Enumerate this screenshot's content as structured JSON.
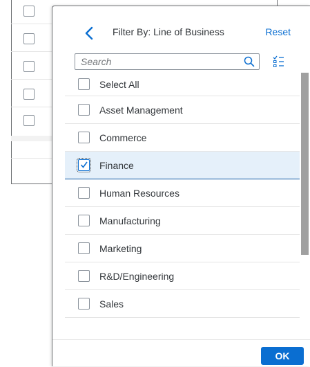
{
  "popover": {
    "title": "Filter By: Line of Business",
    "reset_label": "Reset",
    "ok_label": "OK",
    "back_icon": "navigation-left-arrow",
    "list_icon": "multiselect-list-icon"
  },
  "search": {
    "placeholder": "Search",
    "value": "",
    "icon": "search-icon"
  },
  "list": {
    "select_all_label": "Select All",
    "items": [
      {
        "label": "Asset Management",
        "checked": false
      },
      {
        "label": "Commerce",
        "checked": false
      },
      {
        "label": "Finance",
        "checked": true
      },
      {
        "label": "Human Resources",
        "checked": false
      },
      {
        "label": "Manufacturing",
        "checked": false
      },
      {
        "label": "Marketing",
        "checked": false
      },
      {
        "label": "R&D/Engineering",
        "checked": false
      },
      {
        "label": "Sales",
        "checked": false
      }
    ]
  },
  "colors": {
    "accent": "#0a6ed1",
    "selected_row": "#e5f0fa",
    "text": "#32363a"
  }
}
